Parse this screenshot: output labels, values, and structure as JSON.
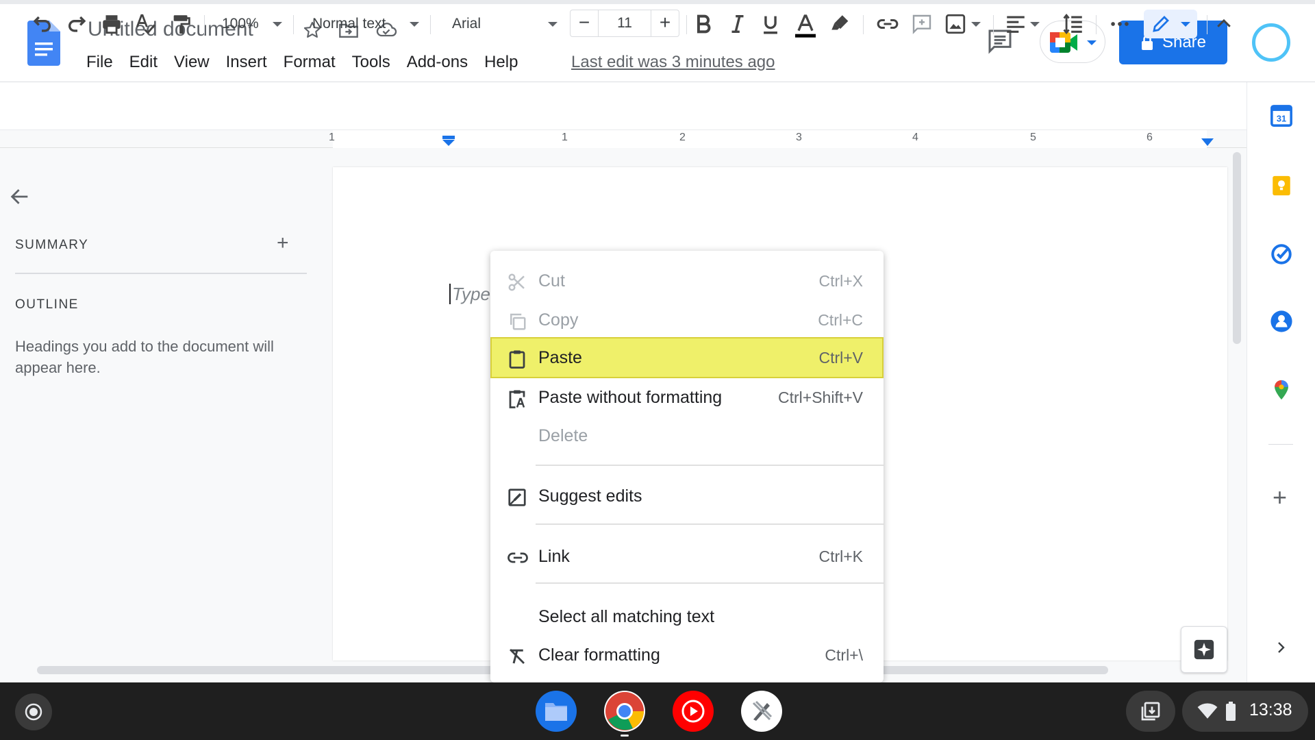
{
  "document": {
    "title": "Untitled document",
    "last_edit": "Last edit was 3 minutes ago"
  },
  "menu": [
    "File",
    "Edit",
    "View",
    "Insert",
    "Format",
    "Tools",
    "Add-ons",
    "Help"
  ],
  "share_label": "Share",
  "toolbar": {
    "zoom": "100%",
    "style": "Normal text",
    "font": "Arial",
    "font_size": "11",
    "minus": "−",
    "plus": "+"
  },
  "ruler_numbers": [
    "1",
    "1",
    "2",
    "3",
    "4",
    "5",
    "6"
  ],
  "outline_panel": {
    "summary_label": "SUMMARY",
    "outline_label": "OUTLINE",
    "hint": "Headings you add to the document will appear here.",
    "add_symbol": "+"
  },
  "page": {
    "placeholder": "Type"
  },
  "context_menu": [
    {
      "label": "Cut",
      "shortcut": "Ctrl+X",
      "icon": "scissors-icon",
      "disabled": true
    },
    {
      "label": "Copy",
      "shortcut": "Ctrl+C",
      "icon": "copy-icon",
      "disabled": true
    },
    {
      "label": "Paste",
      "shortcut": "Ctrl+V",
      "icon": "clipboard-icon",
      "highlighted": true
    },
    {
      "label": "Paste without formatting",
      "shortcut": "Ctrl+Shift+V",
      "icon": "clipboard-text-icon"
    },
    {
      "label": "Delete",
      "shortcut": "",
      "icon": "",
      "disabled": true
    },
    {
      "label": "Suggest edits",
      "shortcut": "",
      "icon": "suggest-edits-icon"
    },
    {
      "label": "Link",
      "shortcut": "Ctrl+K",
      "icon": "link-icon"
    },
    {
      "label": "Select all matching text",
      "shortcut": "",
      "icon": ""
    },
    {
      "label": "Clear formatting",
      "shortcut": "Ctrl+\\",
      "icon": "clear-formatting-icon"
    }
  ],
  "side_panel_add": "+",
  "shelf": {
    "time": "13:38",
    "apps": [
      "files-app-icon",
      "chrome-app-icon",
      "youtube-music-app-icon",
      "canvas-app-icon"
    ]
  },
  "colors": {
    "share_button": "#1a73e8",
    "paste_highlight": "#eff06a",
    "docs_blue": "#4285f4"
  }
}
